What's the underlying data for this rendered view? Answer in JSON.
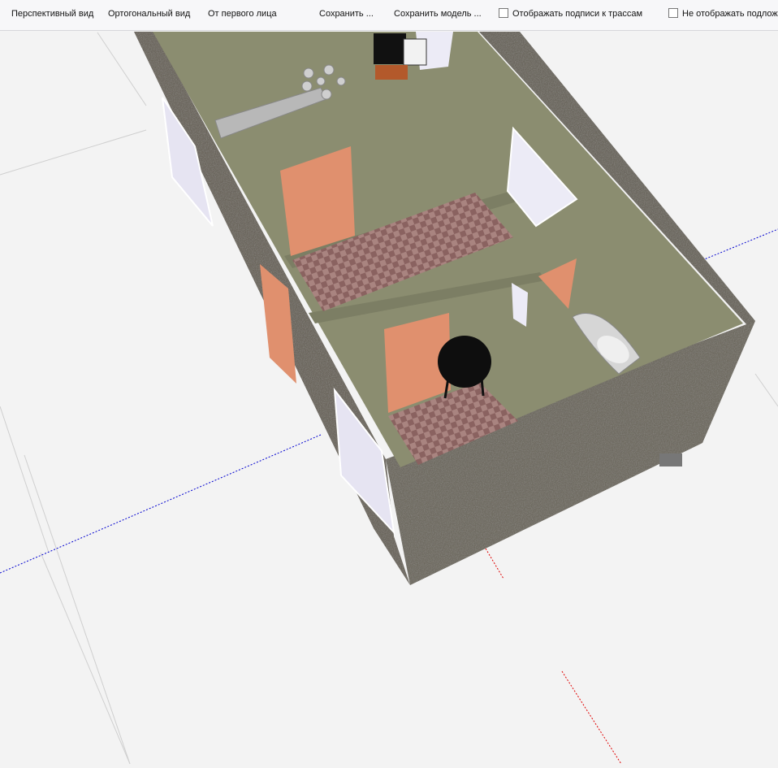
{
  "toolbar": {
    "perspective": "Перспективный вид",
    "orthogonal": "Ортогональный вид",
    "first_person": "От первого лица",
    "save": "Сохранить ...",
    "save_model": "Сохранить модель ...",
    "show_labels": "Отображать подписи к трассам",
    "hide_underlay": "Не отображать подлож"
  },
  "viewport": {
    "background": "#f3f3f3",
    "grid_color": "#d0d0d0",
    "axis_x_color": "#e00000",
    "axis_y_color": "#0000d0",
    "floor_color": "#8b8d70",
    "wall_color": "#66625a",
    "door_color": "#e0906e",
    "rug_color": "#9c7270"
  }
}
